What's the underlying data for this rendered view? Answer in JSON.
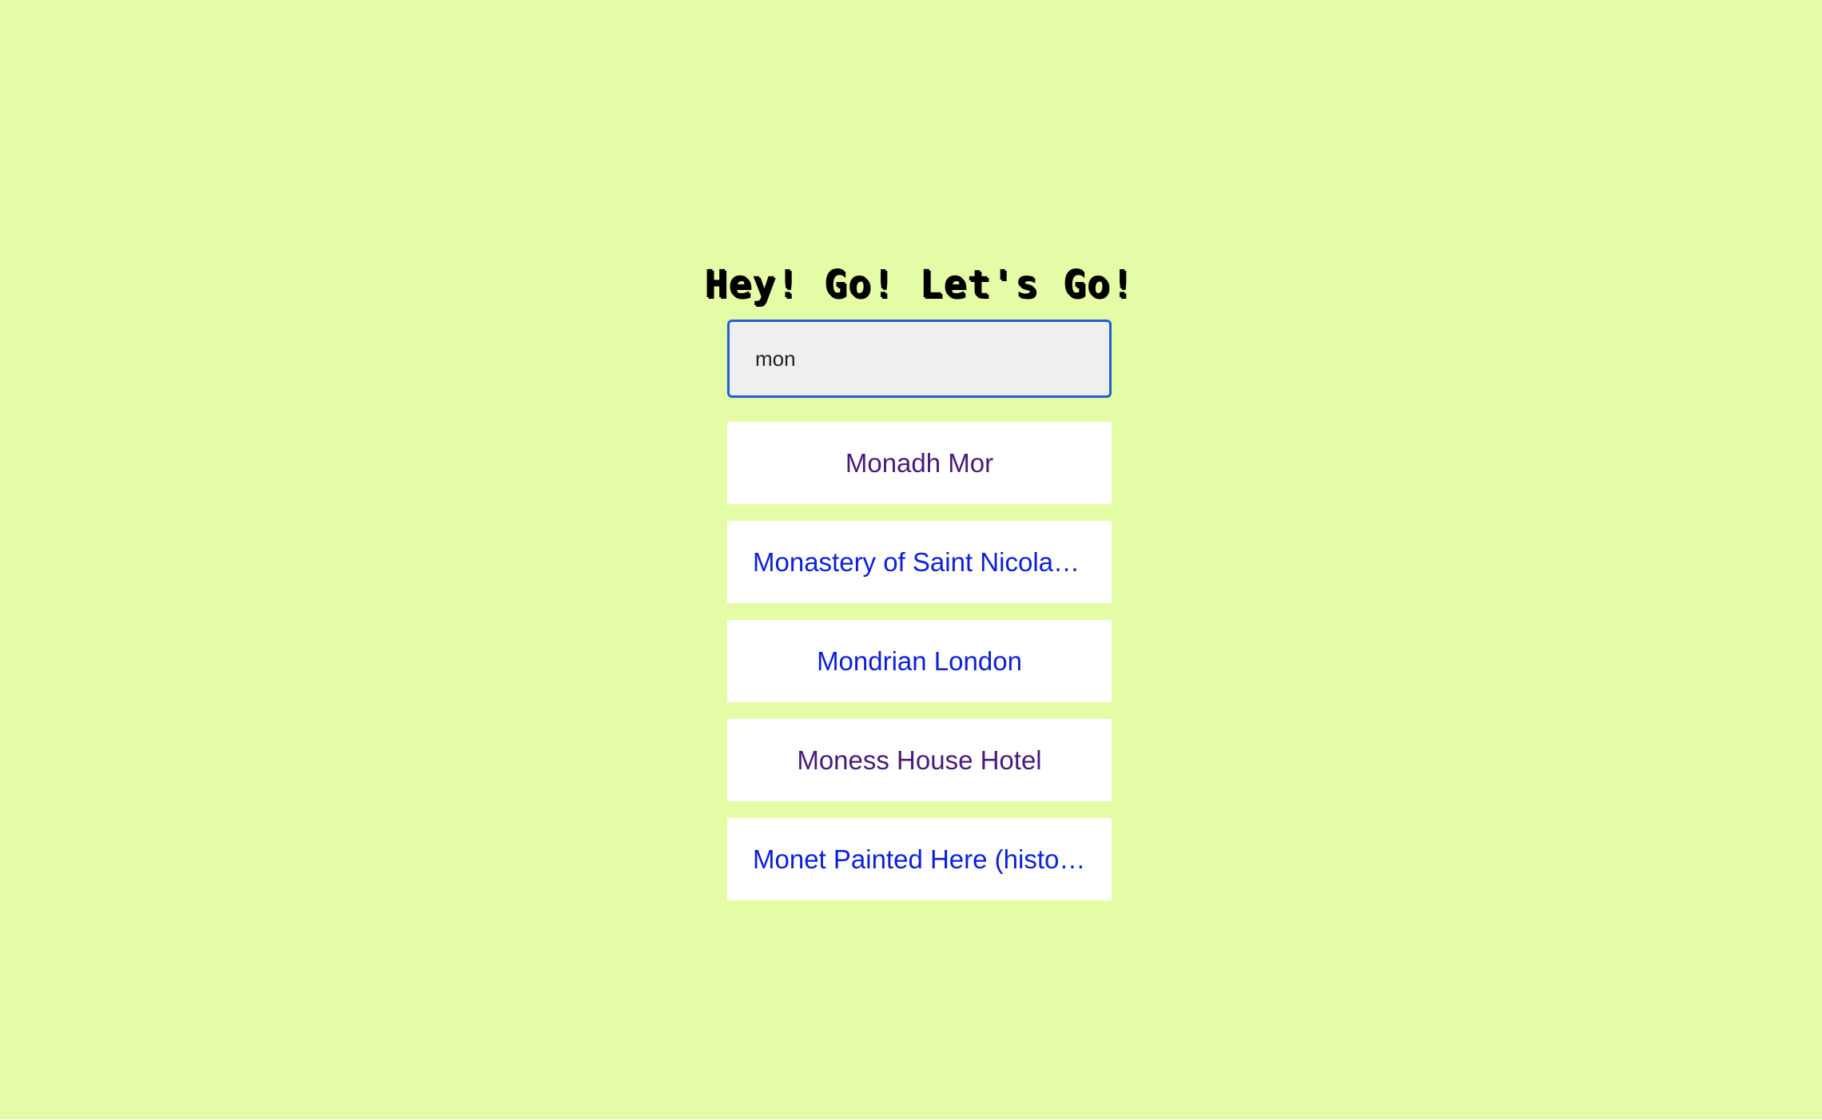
{
  "header": {
    "title": "Hey! Go! Let's Go!"
  },
  "search": {
    "value": "mon",
    "placeholder": ""
  },
  "results": [
    {
      "label": "Monadh Mor",
      "state": "visited"
    },
    {
      "label": "Monastery of Saint Nicolas (historical)",
      "state": "unvisited"
    },
    {
      "label": "Mondrian London",
      "state": "unvisited"
    },
    {
      "label": "Moness House Hotel",
      "state": "visited"
    },
    {
      "label": "Monet Painted Here (historical)",
      "state": "unvisited"
    }
  ],
  "colors": {
    "background": "#e5fca6",
    "input_border": "#1f5fd6",
    "link": "#0d1fd9",
    "visited_link": "#4a1a7a"
  }
}
